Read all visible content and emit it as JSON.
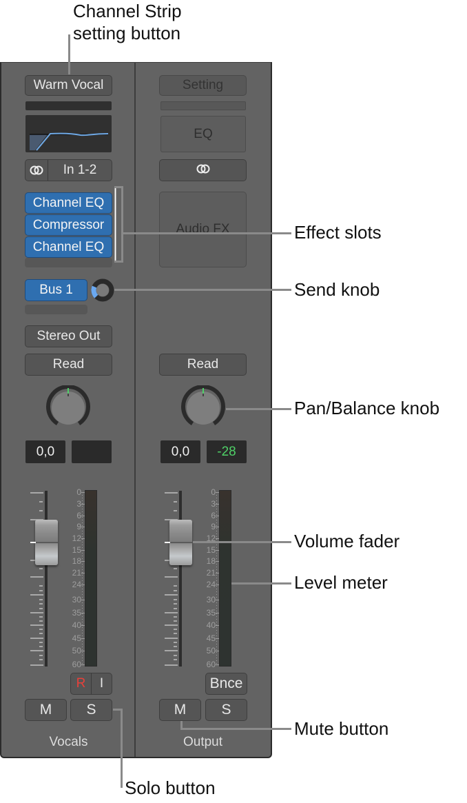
{
  "callouts": {
    "channel_strip_setting": [
      "Channel Strip",
      "setting button"
    ],
    "effect_slots": "Effect slots",
    "send_knob": "Send knob",
    "pan_balance_knob": "Pan/Balance knob",
    "volume_fader": "Volume fader",
    "level_meter": "Level meter",
    "mute_button": "Mute button",
    "solo_button": "Solo button"
  },
  "strips": [
    {
      "name": "Vocals",
      "setting": "Warm Vocal",
      "input_icon": "stereo-link-icon",
      "input": "In 1-2",
      "effects": [
        "Channel EQ",
        "Compressor",
        "Channel EQ"
      ],
      "send": {
        "label": "Bus 1",
        "level_fraction": 0.25
      },
      "output": "Stereo Out",
      "automation": "Read",
      "pan_value": 0,
      "volume": "0,0",
      "peak": "",
      "record": "R",
      "input_monitor": "I",
      "mute": "M",
      "solo": "S"
    },
    {
      "name": "Output",
      "setting": "Setting",
      "eq": "EQ",
      "input_icon": "stereo-link-icon",
      "audio_fx": "Audio FX",
      "automation": "Read",
      "pan_value": 0,
      "volume": "0,0",
      "peak": "-28",
      "bounce": "Bnce",
      "mute": "M",
      "solo": "S"
    }
  ],
  "meter_scale": [
    "0",
    "3",
    "6",
    "9",
    "12",
    "15",
    "18",
    "21",
    "24",
    "30",
    "35",
    "40",
    "45",
    "50",
    "60"
  ],
  "colors": {
    "panel": "#636363",
    "plugin_blue": "#2f6fb0",
    "peak_green": "#4fd067",
    "record_red": "#e8403a",
    "send_blue": "#6aa8f0"
  }
}
